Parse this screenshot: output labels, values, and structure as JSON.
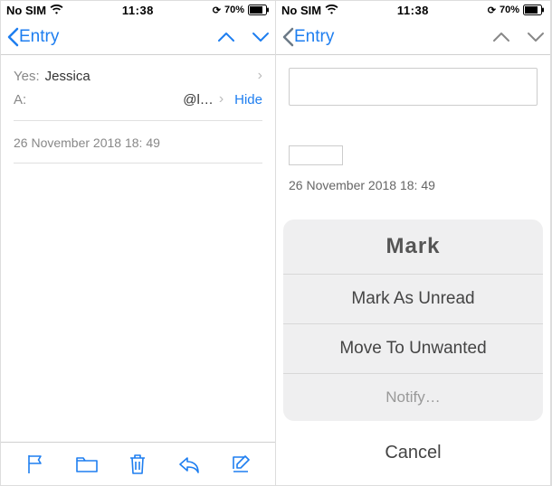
{
  "status": {
    "carrier": "No SIM",
    "time": "11:38",
    "battery_pct": "70%"
  },
  "nav": {
    "back_label": "Entry"
  },
  "left": {
    "to_label": "Yes:",
    "to_value": "Jessica",
    "from_label": "A:",
    "from_value": "@l…",
    "hide": "Hide",
    "timestamp": "26 November 2018 18: 49"
  },
  "right": {
    "timestamp": "26 November 2018 18: 49"
  },
  "sheet": {
    "title": "Mark",
    "items": [
      "Mark As Unread",
      "Move To Unwanted",
      "Notify…"
    ],
    "cancel": "Cancel"
  },
  "colors": {
    "accent": "#1e7ef0",
    "dim_bg": "#a6a6a6"
  }
}
